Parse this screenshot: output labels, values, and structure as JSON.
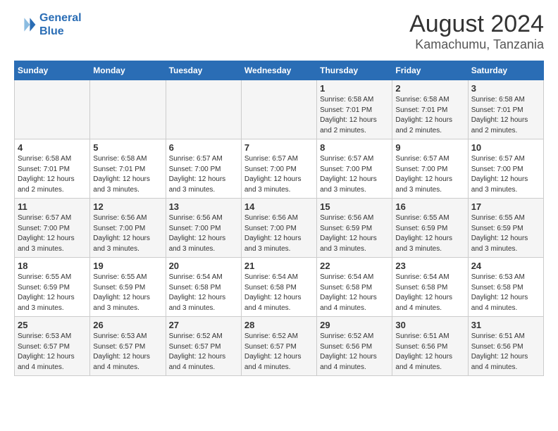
{
  "header": {
    "logo_line1": "General",
    "logo_line2": "Blue",
    "title": "August 2024",
    "subtitle": "Kamachumu, Tanzania"
  },
  "weekdays": [
    "Sunday",
    "Monday",
    "Tuesday",
    "Wednesday",
    "Thursday",
    "Friday",
    "Saturday"
  ],
  "weeks": [
    [
      {
        "day": "",
        "info": ""
      },
      {
        "day": "",
        "info": ""
      },
      {
        "day": "",
        "info": ""
      },
      {
        "day": "",
        "info": ""
      },
      {
        "day": "1",
        "info": "Sunrise: 6:58 AM\nSunset: 7:01 PM\nDaylight: 12 hours\nand 2 minutes."
      },
      {
        "day": "2",
        "info": "Sunrise: 6:58 AM\nSunset: 7:01 PM\nDaylight: 12 hours\nand 2 minutes."
      },
      {
        "day": "3",
        "info": "Sunrise: 6:58 AM\nSunset: 7:01 PM\nDaylight: 12 hours\nand 2 minutes."
      }
    ],
    [
      {
        "day": "4",
        "info": "Sunrise: 6:58 AM\nSunset: 7:01 PM\nDaylight: 12 hours\nand 2 minutes."
      },
      {
        "day": "5",
        "info": "Sunrise: 6:58 AM\nSunset: 7:01 PM\nDaylight: 12 hours\nand 3 minutes."
      },
      {
        "day": "6",
        "info": "Sunrise: 6:57 AM\nSunset: 7:00 PM\nDaylight: 12 hours\nand 3 minutes."
      },
      {
        "day": "7",
        "info": "Sunrise: 6:57 AM\nSunset: 7:00 PM\nDaylight: 12 hours\nand 3 minutes."
      },
      {
        "day": "8",
        "info": "Sunrise: 6:57 AM\nSunset: 7:00 PM\nDaylight: 12 hours\nand 3 minutes."
      },
      {
        "day": "9",
        "info": "Sunrise: 6:57 AM\nSunset: 7:00 PM\nDaylight: 12 hours\nand 3 minutes."
      },
      {
        "day": "10",
        "info": "Sunrise: 6:57 AM\nSunset: 7:00 PM\nDaylight: 12 hours\nand 3 minutes."
      }
    ],
    [
      {
        "day": "11",
        "info": "Sunrise: 6:57 AM\nSunset: 7:00 PM\nDaylight: 12 hours\nand 3 minutes."
      },
      {
        "day": "12",
        "info": "Sunrise: 6:56 AM\nSunset: 7:00 PM\nDaylight: 12 hours\nand 3 minutes."
      },
      {
        "day": "13",
        "info": "Sunrise: 6:56 AM\nSunset: 7:00 PM\nDaylight: 12 hours\nand 3 minutes."
      },
      {
        "day": "14",
        "info": "Sunrise: 6:56 AM\nSunset: 7:00 PM\nDaylight: 12 hours\nand 3 minutes."
      },
      {
        "day": "15",
        "info": "Sunrise: 6:56 AM\nSunset: 6:59 PM\nDaylight: 12 hours\nand 3 minutes."
      },
      {
        "day": "16",
        "info": "Sunrise: 6:55 AM\nSunset: 6:59 PM\nDaylight: 12 hours\nand 3 minutes."
      },
      {
        "day": "17",
        "info": "Sunrise: 6:55 AM\nSunset: 6:59 PM\nDaylight: 12 hours\nand 3 minutes."
      }
    ],
    [
      {
        "day": "18",
        "info": "Sunrise: 6:55 AM\nSunset: 6:59 PM\nDaylight: 12 hours\nand 3 minutes."
      },
      {
        "day": "19",
        "info": "Sunrise: 6:55 AM\nSunset: 6:59 PM\nDaylight: 12 hours\nand 3 minutes."
      },
      {
        "day": "20",
        "info": "Sunrise: 6:54 AM\nSunset: 6:58 PM\nDaylight: 12 hours\nand 3 minutes."
      },
      {
        "day": "21",
        "info": "Sunrise: 6:54 AM\nSunset: 6:58 PM\nDaylight: 12 hours\nand 4 minutes."
      },
      {
        "day": "22",
        "info": "Sunrise: 6:54 AM\nSunset: 6:58 PM\nDaylight: 12 hours\nand 4 minutes."
      },
      {
        "day": "23",
        "info": "Sunrise: 6:54 AM\nSunset: 6:58 PM\nDaylight: 12 hours\nand 4 minutes."
      },
      {
        "day": "24",
        "info": "Sunrise: 6:53 AM\nSunset: 6:58 PM\nDaylight: 12 hours\nand 4 minutes."
      }
    ],
    [
      {
        "day": "25",
        "info": "Sunrise: 6:53 AM\nSunset: 6:57 PM\nDaylight: 12 hours\nand 4 minutes."
      },
      {
        "day": "26",
        "info": "Sunrise: 6:53 AM\nSunset: 6:57 PM\nDaylight: 12 hours\nand 4 minutes."
      },
      {
        "day": "27",
        "info": "Sunrise: 6:52 AM\nSunset: 6:57 PM\nDaylight: 12 hours\nand 4 minutes."
      },
      {
        "day": "28",
        "info": "Sunrise: 6:52 AM\nSunset: 6:57 PM\nDaylight: 12 hours\nand 4 minutes."
      },
      {
        "day": "29",
        "info": "Sunrise: 6:52 AM\nSunset: 6:56 PM\nDaylight: 12 hours\nand 4 minutes."
      },
      {
        "day": "30",
        "info": "Sunrise: 6:51 AM\nSunset: 6:56 PM\nDaylight: 12 hours\nand 4 minutes."
      },
      {
        "day": "31",
        "info": "Sunrise: 6:51 AM\nSunset: 6:56 PM\nDaylight: 12 hours\nand 4 minutes."
      }
    ]
  ]
}
